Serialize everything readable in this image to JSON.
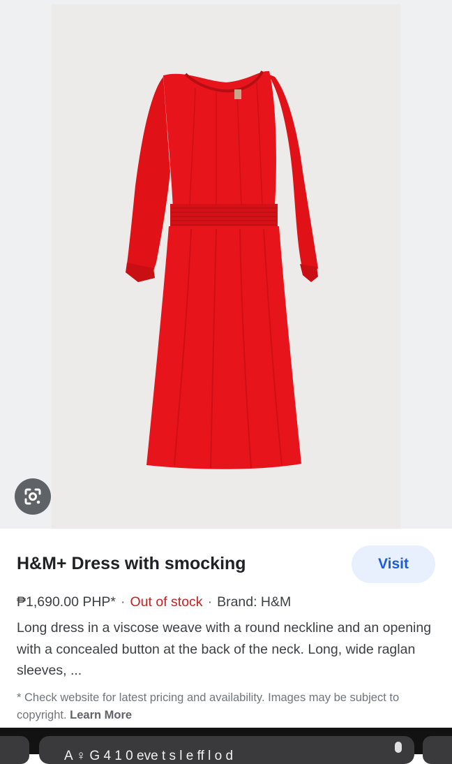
{
  "product": {
    "title": "H&M+ Dress with smocking",
    "visit_label": "Visit",
    "price": "₱1,690.00 PHP*",
    "separator": "·",
    "stock_status": "Out of stock",
    "brand": "Brand: H&M",
    "description": "Long dress in a viscose weave with a round neckline and an opening with a concealed button at the back of the neck. Long, wide raglan sleeves, ...",
    "disclaimer": "* Check website for latest pricing and availability. Images may be subject to copyright.",
    "learn_more": "Learn More"
  },
  "bottom_bar": {
    "text": "A  ♀ G 4 1 0  eve  t  s  l  e    ff    l  o  d"
  },
  "colors": {
    "dress": "#e8141b",
    "accent_blue": "#1a5dd8",
    "out_of_stock": "#c5221f"
  },
  "icons": {
    "lens": "google-lens-icon"
  }
}
